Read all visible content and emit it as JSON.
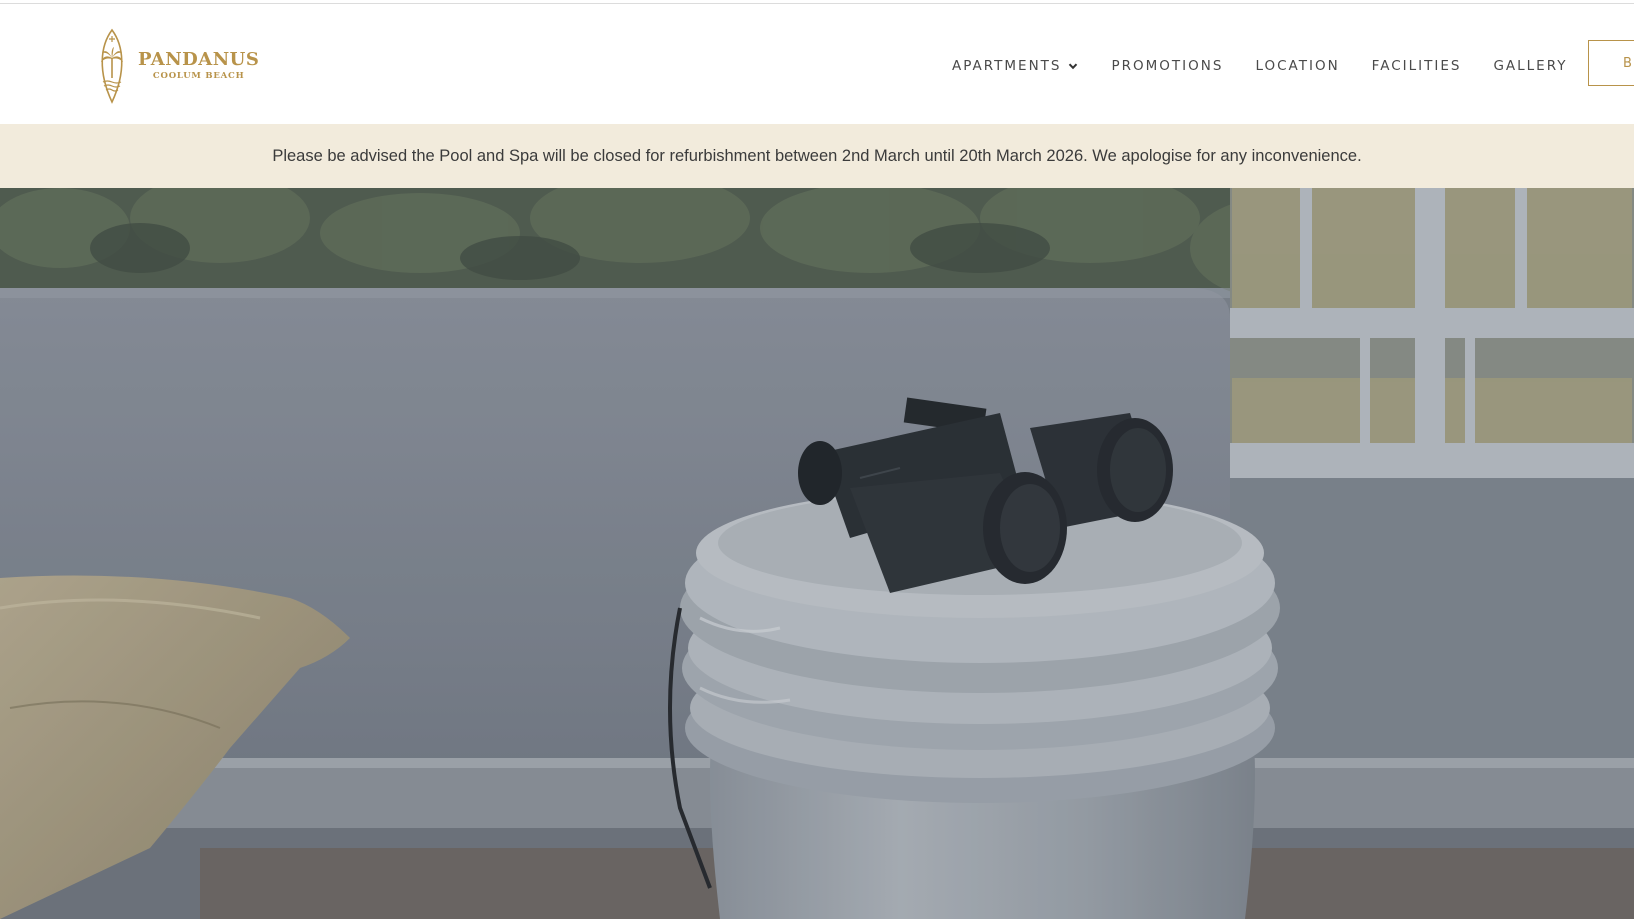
{
  "brand": {
    "name": "PANDANUS",
    "tagline": "COOLUM BEACH",
    "color": "#b8934a"
  },
  "nav": {
    "items": [
      {
        "label": "APARTMENTS",
        "has_dropdown": true,
        "icon": "chevron-down-icon"
      },
      {
        "label": "PROMOTIONS",
        "has_dropdown": false
      },
      {
        "label": "LOCATION",
        "has_dropdown": false
      },
      {
        "label": "FACILITIES",
        "has_dropdown": false
      },
      {
        "label": "GALLERY",
        "has_dropdown": false
      }
    ],
    "book_button_label": "B"
  },
  "notice": {
    "text": "Please be advised the Pool and Spa will be closed for refurbishment between 2nd March until 20th March 2026. We apologise for any inconvenience.",
    "background": "#f2ebdc"
  },
  "hero": {
    "subject": "binoculars-on-ceramic-stool"
  }
}
